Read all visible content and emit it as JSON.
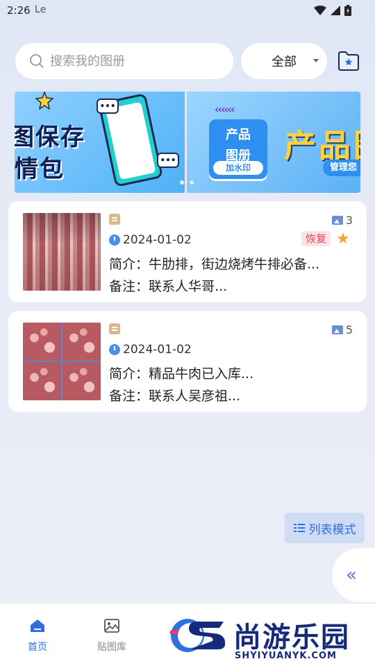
{
  "status_bar": {
    "time": "2:26",
    "extra": "ᒪe"
  },
  "search": {
    "placeholder": "搜索我的图册"
  },
  "filter": {
    "selected": "全部"
  },
  "banner": {
    "slide_a": {
      "line1": "图保存",
      "line2": "情包",
      "bubble": "•••"
    },
    "slide_b": {
      "arrows": "‹‹‹‹‹‹",
      "badge_l1": "产品",
      "badge_l2": "图册",
      "badge_l3": "加水印",
      "big_text": "产品图",
      "pill": "管理您"
    },
    "dot_count": 2,
    "active_dot": 0
  },
  "albums": [
    {
      "date": "2024-01-02",
      "description": "简介：牛肋排，街边烧烤牛排必备...",
      "remark": "备注：联系人华哥...",
      "image_count": "3",
      "restore_label": "恢复",
      "starred": true
    },
    {
      "date": "2024-01-02",
      "description": "简介：精品牛肉已入库...",
      "remark": "备注：联系人吴彦祖...",
      "image_count": "5",
      "restore_label": "",
      "starred": false
    }
  ],
  "list_mode": {
    "label": "列表模式"
  },
  "collapse": {
    "label": "«"
  },
  "tabs": [
    {
      "label": "首页",
      "active": true
    },
    {
      "label": "贴图库",
      "active": false
    }
  ],
  "watermark": {
    "text": "尚游乐园",
    "url": "SHYIYUANYK.COM"
  },
  "colors": {
    "accent": "#2f6fe0",
    "star": "#f5a623",
    "restore_bg": "#fde2e6",
    "restore_fg": "#e0435a"
  }
}
